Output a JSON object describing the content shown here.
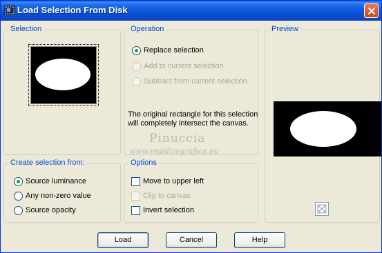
{
  "window": {
    "title": "Load Selection From Disk"
  },
  "selection": {
    "group_title": "Selection"
  },
  "operation": {
    "group_title": "Operation",
    "options": [
      {
        "label": "Replace selection",
        "checked": true,
        "enabled": true
      },
      {
        "label": "Add to current selection",
        "checked": false,
        "enabled": false
      },
      {
        "label": "Subtract from current selection",
        "checked": false,
        "enabled": false
      }
    ],
    "info_line_1": "The original rectangle for this selection",
    "info_line_2": "will completely intersect the canvas."
  },
  "watermark": {
    "name": "Pinuccia",
    "url": "www.maidiregrafica.eu"
  },
  "preview": {
    "group_title": "Preview"
  },
  "create_from": {
    "group_title": "Create selection from:",
    "options": [
      {
        "label": "Source luminance",
        "checked": true
      },
      {
        "label": "Any non-zero value",
        "checked": false
      },
      {
        "label": "Source opacity",
        "checked": false
      }
    ]
  },
  "options": {
    "group_title": "Options",
    "checks": [
      {
        "label": "Move to upper left",
        "checked": false,
        "enabled": true
      },
      {
        "label": "Clip to canvas",
        "checked": false,
        "enabled": false
      },
      {
        "label": "Invert selection",
        "checked": false,
        "enabled": true
      }
    ]
  },
  "buttons": {
    "load": "Load",
    "cancel": "Cancel",
    "help": "Help"
  },
  "icons": {
    "app": "selection-app-icon",
    "close": "close-icon",
    "proof": "checkerboard-proof-icon"
  },
  "colors": {
    "titlebar": "#0a58d8",
    "group_title": "#0046d5",
    "radio_dot": "#21a121",
    "close_button": "#d2522c"
  }
}
